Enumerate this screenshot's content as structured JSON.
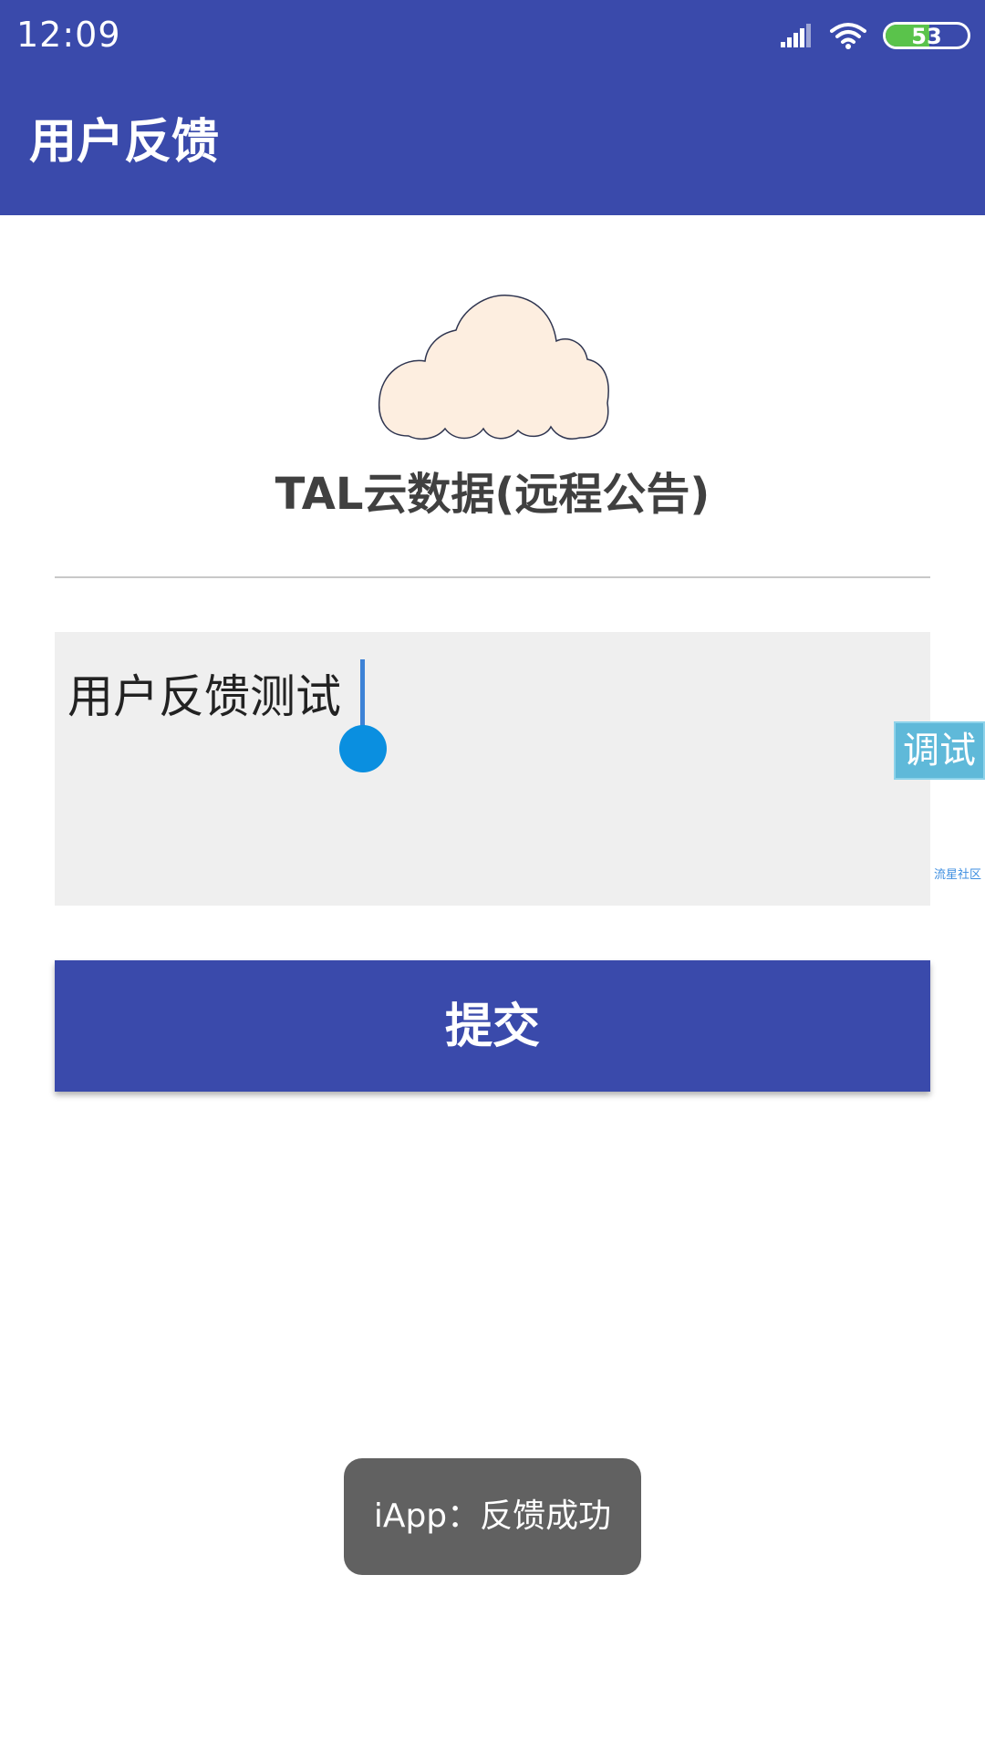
{
  "status_bar": {
    "time": "12:09",
    "battery_level": "53",
    "battery_fraction": 0.53,
    "signal_icon": "signal-bars-icon",
    "wifi_icon": "wifi-icon"
  },
  "app_bar": {
    "title": "用户反馈",
    "color": "#3a4aab"
  },
  "logo": {
    "icon": "cloud-icon",
    "fill_color": "#fdeee0"
  },
  "headline": "TAL云数据(远程公告)",
  "feedback": {
    "value": "用户反馈测试"
  },
  "debug_tab": {
    "label": "调试"
  },
  "community_link": {
    "label": "流星社区"
  },
  "submit_button": {
    "label": "提交"
  },
  "toast": {
    "message": "iApp：反馈成功"
  }
}
